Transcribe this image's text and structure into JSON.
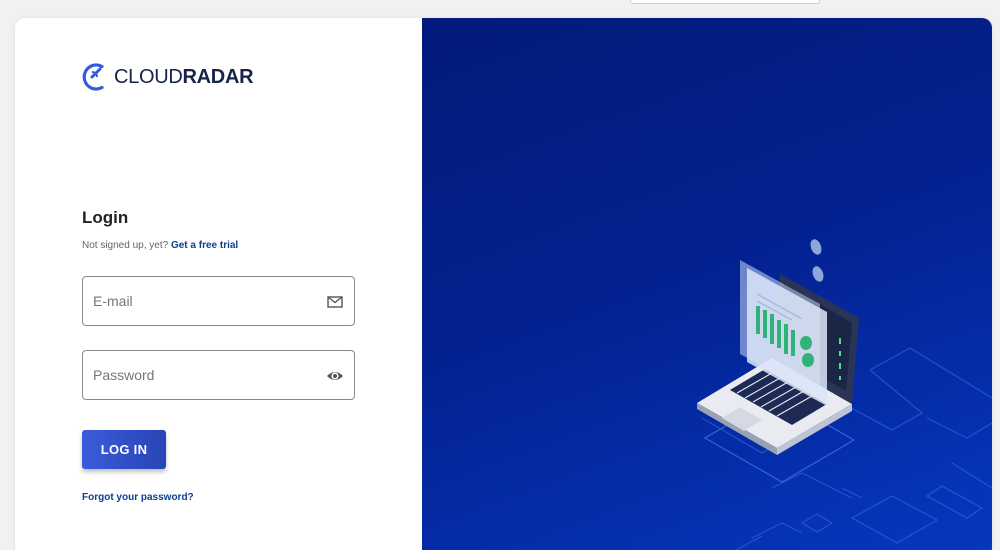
{
  "brand": {
    "name_light": "CLOUD",
    "name_bold": "RADAR",
    "accent_color": "#2f5be0",
    "panel_color": "#03218f"
  },
  "login": {
    "title": "Login",
    "signup_prompt": "Not signed up, yet?",
    "signup_link": "Get a free trial",
    "email_placeholder": "E-mail",
    "email_icon": "envelope-icon",
    "password_placeholder": "Password",
    "password_icon": "eye-icon",
    "submit_label": "LOG IN",
    "forgot_link": "Forgot your password?"
  }
}
